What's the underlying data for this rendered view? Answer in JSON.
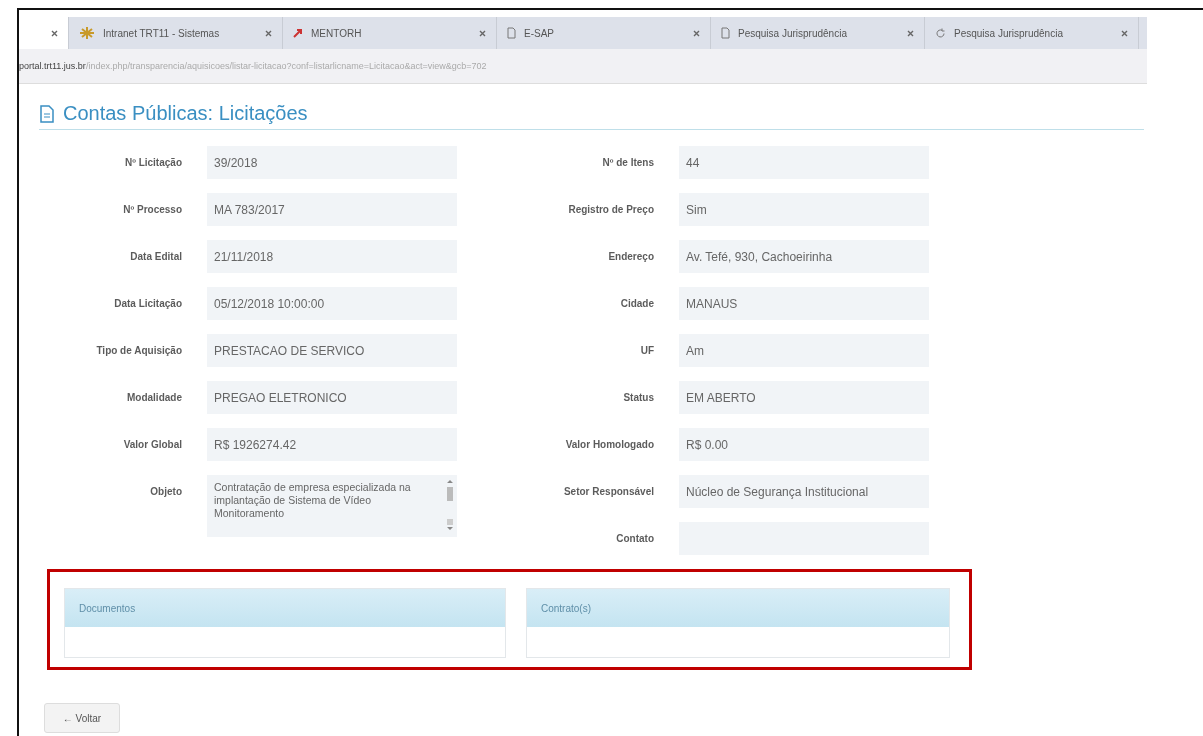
{
  "browser": {
    "tabs": [
      {
        "selected": true,
        "kind": "blank"
      },
      {
        "title": "Intranet TRT11 - Sistemas",
        "selected": false,
        "kind": "star"
      },
      {
        "title": "MENTORH",
        "selected": false,
        "kind": "arrow"
      },
      {
        "title": "E-SAP",
        "selected": false,
        "kind": "page"
      },
      {
        "title": "Pesquisa Jurisprudência",
        "selected": false,
        "kind": "page"
      },
      {
        "title": "Pesquisa Jurisprudência",
        "selected": false,
        "kind": "reload"
      }
    ],
    "address": {
      "host": "portal.trt11.jus.br",
      "path": "/index.php/transparencia/aquisicoes/listar-licitacao?conf=listarlicname=Licitacao&act=view&gcb=702"
    }
  },
  "page": {
    "title": "Contas Públicas: Licitações",
    "left_fields": [
      {
        "label": "Nº Licitação",
        "value": "39/2018",
        "kind": "field"
      },
      {
        "label": "Nº Processo",
        "value": "MA 783/2017",
        "kind": "field"
      },
      {
        "label": "Data Edital",
        "value": "21/11/2018",
        "kind": "field"
      },
      {
        "label": "Data Licitação",
        "value": "05/12/2018 10:00:00",
        "kind": "field"
      },
      {
        "label": "Tipo de Aquisição",
        "value": "PRESTACAO DE SERVICO",
        "kind": "field"
      },
      {
        "label": "Modalidade",
        "value": "PREGAO ELETRONICO",
        "kind": "field"
      },
      {
        "label": "Valor Global",
        "value": "R$ 1926274.42",
        "kind": "field"
      },
      {
        "label": "Objeto",
        "value": "Contratação de empresa especializada na implantação de Sistema de Vídeo Monitoramento",
        "kind": "textarea"
      }
    ],
    "right_fields": [
      {
        "label": "Nº de Itens",
        "value": "44",
        "kind": "field"
      },
      {
        "label": "Registro de Preço",
        "value": "Sim",
        "kind": "field"
      },
      {
        "label": "Endereço",
        "value": "Av. Tefé, 930, Cachoeirinha",
        "kind": "field"
      },
      {
        "label": "Cidade",
        "value": "MANAUS",
        "kind": "field"
      },
      {
        "label": "UF",
        "value": "Am",
        "kind": "field"
      },
      {
        "label": "Status",
        "value": "EM ABERTO",
        "kind": "field"
      },
      {
        "label": "Valor Homologado",
        "value": "R$ 0.00",
        "kind": "field"
      },
      {
        "label": "Setor Responsável",
        "value": "Núcleo de Segurança Institucional",
        "kind": "field"
      },
      {
        "label": "Contato",
        "kind": "field"
      }
    ],
    "panels": [
      {
        "title": "Documentos"
      },
      {
        "title": "Contrato(s)"
      }
    ],
    "back_button": {
      "arrow": "←",
      "label": "Voltar"
    }
  }
}
